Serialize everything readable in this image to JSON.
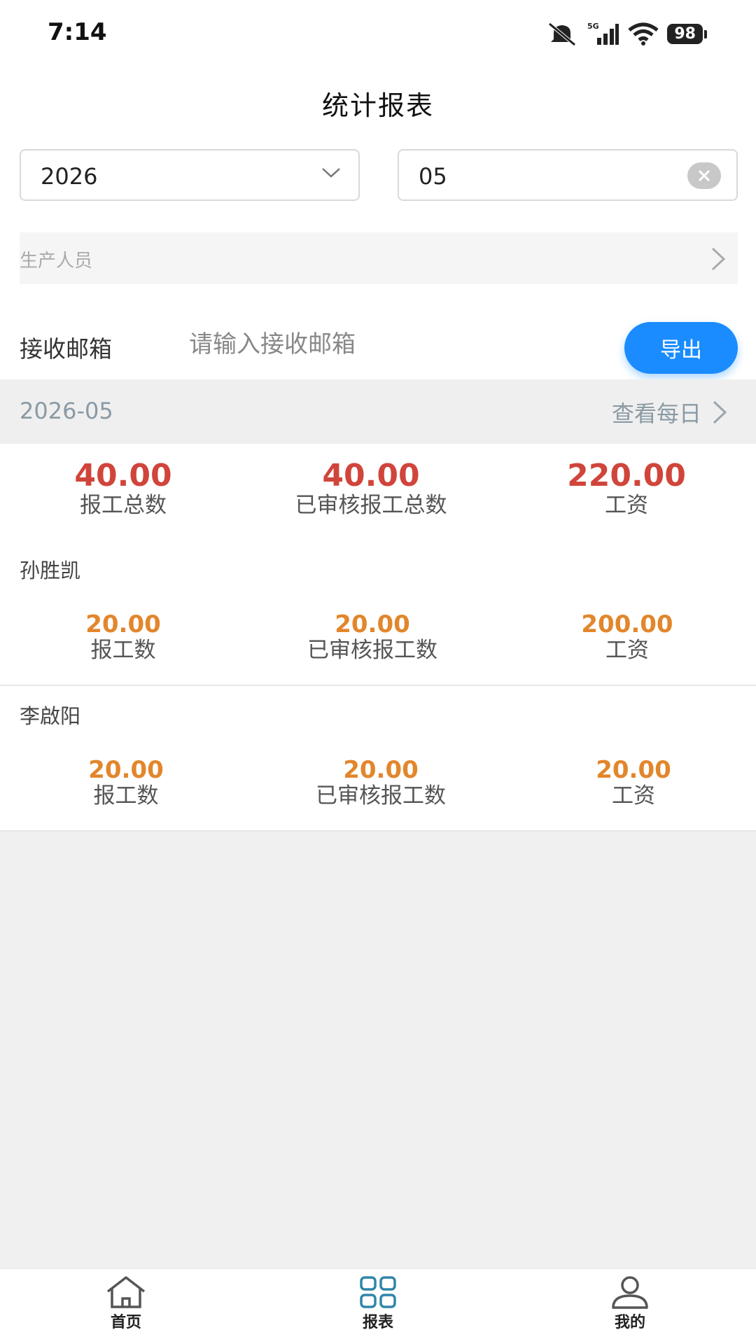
{
  "status_bar": {
    "time": "7:14",
    "network": "5G",
    "battery": "98"
  },
  "header": {
    "title": "统计报表"
  },
  "filters": {
    "year": "2026",
    "month": "05",
    "personnel_placeholder": "生产人员",
    "email_label": "接收邮箱",
    "email_placeholder": "请输入接收邮箱",
    "export_label": "导出"
  },
  "period": {
    "label": "2026-05",
    "view_daily": "查看每日"
  },
  "summary": {
    "total_reports": {
      "value": "40.00",
      "label": "报工总数"
    },
    "approved_total": {
      "value": "40.00",
      "label": "已审核报工总数"
    },
    "salary": {
      "value": "220.00",
      "label": "工资"
    }
  },
  "workers": [
    {
      "name": "孙胜凯",
      "reports": {
        "value": "20.00",
        "label": "报工数"
      },
      "approved": {
        "value": "20.00",
        "label": "已审核报工数"
      },
      "salary": {
        "value": "200.00",
        "label": "工资"
      }
    },
    {
      "name": "李啟阳",
      "reports": {
        "value": "20.00",
        "label": "报工数"
      },
      "approved": {
        "value": "20.00",
        "label": "已审核报工数"
      },
      "salary": {
        "value": "20.00",
        "label": "工资"
      }
    }
  ],
  "nav": {
    "home": "首页",
    "reports": "报表",
    "mine": "我的"
  },
  "colors": {
    "accent": "#1a8cff",
    "summary_value": "#d0453b",
    "worker_value": "#e2862c",
    "nav_active": "#2f86a8"
  }
}
